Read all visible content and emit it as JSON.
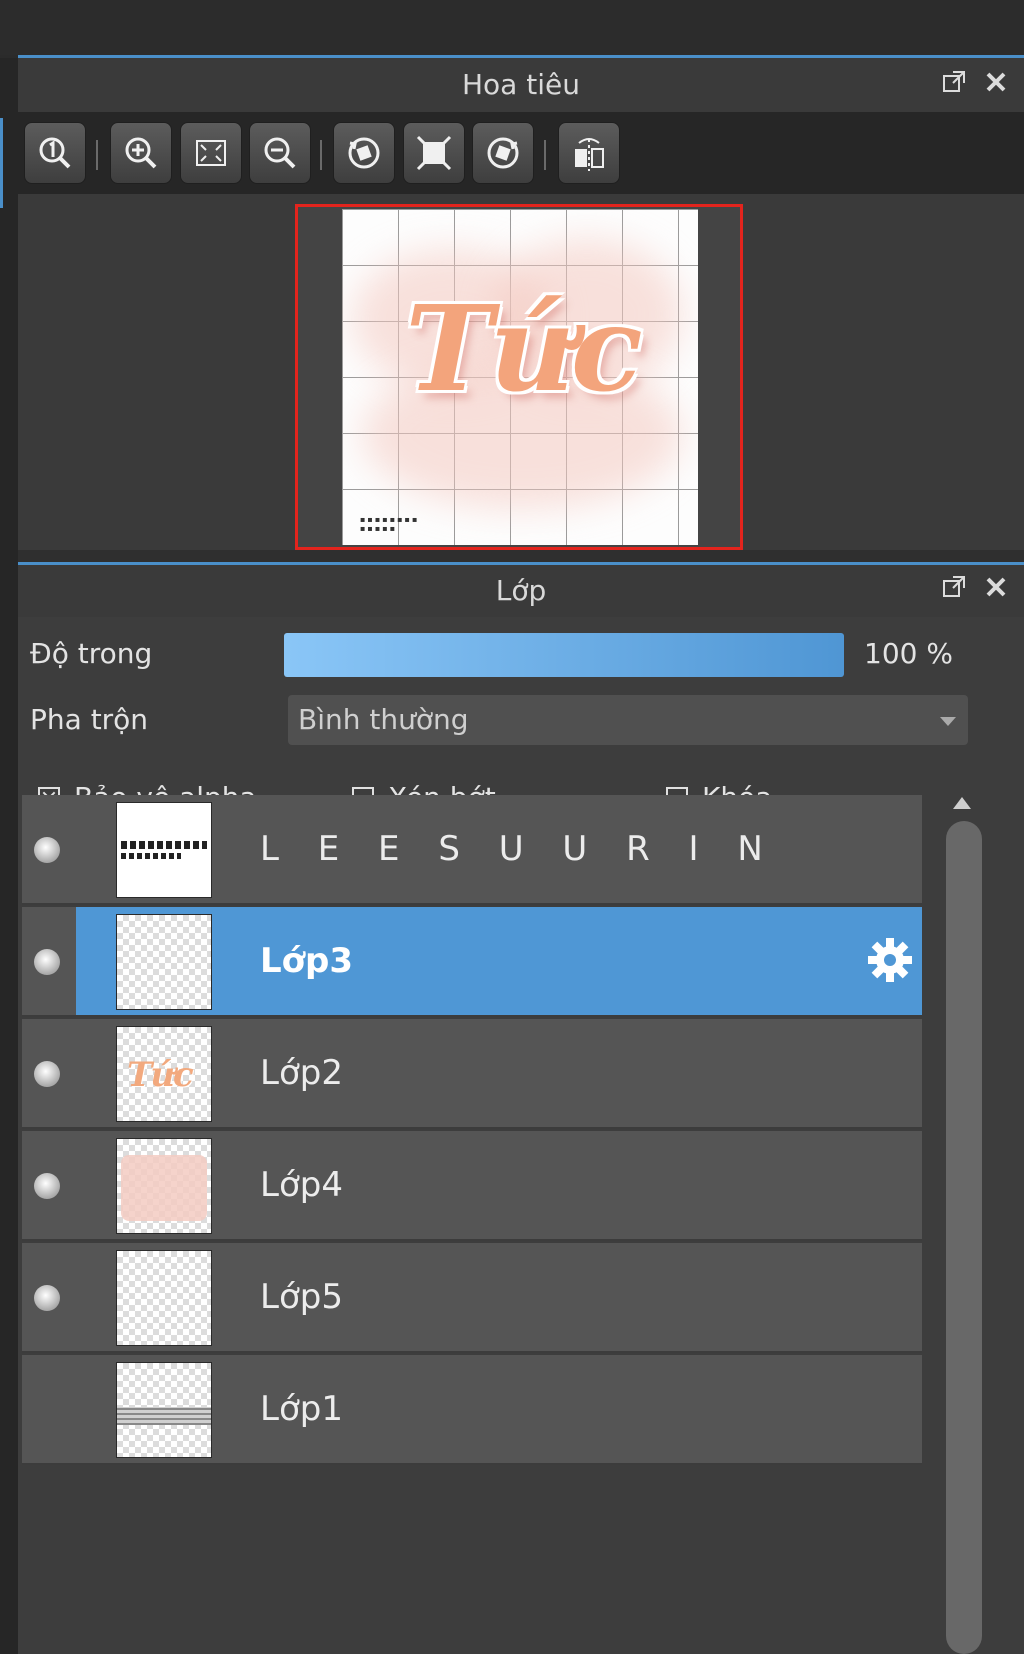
{
  "navigator": {
    "title": "Hoa tiêu",
    "toolbar": [
      "zoom-actual-size",
      "zoom-in",
      "fit-to-window",
      "zoom-out",
      "rotate-left",
      "fit-rotate",
      "rotate-right",
      "flip-horizontal"
    ]
  },
  "layers_panel": {
    "title": "Lớp",
    "opacity_label": "Độ trong",
    "opacity_value": "100 %",
    "opacity_fraction": 1.0,
    "blend_label": "Pha trộn",
    "blend_value": "Bình thường",
    "alpha_label": "Bảo vệ alpha",
    "alpha_checked": true,
    "clip_label": "Xén bớt",
    "clip_checked": false,
    "lock_label": "Khóa",
    "lock_checked": false,
    "layers": [
      {
        "name": "L E E S U U R I N",
        "selected": false,
        "visible": true
      },
      {
        "name": "Lớp3",
        "selected": true,
        "visible": true
      },
      {
        "name": "Lớp2",
        "selected": false,
        "visible": true
      },
      {
        "name": "Lớp4",
        "selected": false,
        "visible": true
      },
      {
        "name": "Lớp5",
        "selected": false,
        "visible": true
      },
      {
        "name": "Lớp1",
        "selected": false,
        "visible": false
      }
    ]
  },
  "colors": {
    "accent": "#4a8fc9",
    "selection": "#4f97d5",
    "frame": "#e3241d"
  }
}
